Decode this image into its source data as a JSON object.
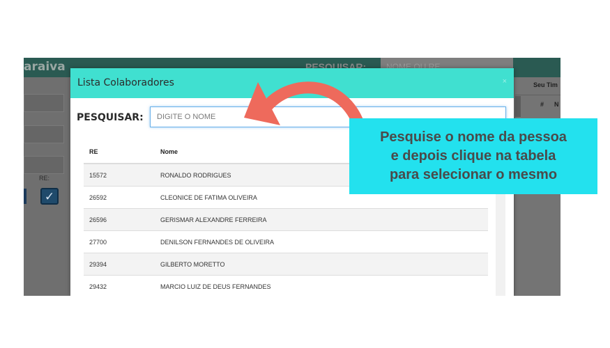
{
  "background_app": {
    "brand": "araiva",
    "search_label": "PESQUISAR:",
    "search_placeholder": "NOME OU RE",
    "re_label": "RE:",
    "right_panel_label": "Seu Tim",
    "right_col_hash": "#",
    "right_col_n": "N"
  },
  "modal": {
    "title": "Lista Colaboradores",
    "close_label": "×",
    "search_label": "PESQUISAR:",
    "search_placeholder": "DIGITE O NOME",
    "table": {
      "headers": {
        "re": "RE",
        "name": "Nome"
      },
      "rows": [
        {
          "re": "15572",
          "name": "RONALDO RODRIGUES"
        },
        {
          "re": "26592",
          "name": "CLEONICE DE FATIMA OLIVEIRA"
        },
        {
          "re": "26596",
          "name": "GERISMAR ALEXANDRE FERREIRA"
        },
        {
          "re": "27700",
          "name": "DENILSON FERNANDES DE OLIVEIRA"
        },
        {
          "re": "29394",
          "name": "GILBERTO MORETTO"
        },
        {
          "re": "29432",
          "name": "MARCIO LUIZ DE DEUS FERNANDES"
        }
      ]
    }
  },
  "annotation": {
    "lines": [
      "Pesquise o nome da pessoa",
      "e depois clique na tabela",
      "para selecionar o mesmo"
    ],
    "callout_color": "#23e1ee",
    "arrow_color": "#ee6a5c"
  },
  "colors": {
    "modal_header": "#40e0d0",
    "background_topbar": "#2a5a52"
  }
}
